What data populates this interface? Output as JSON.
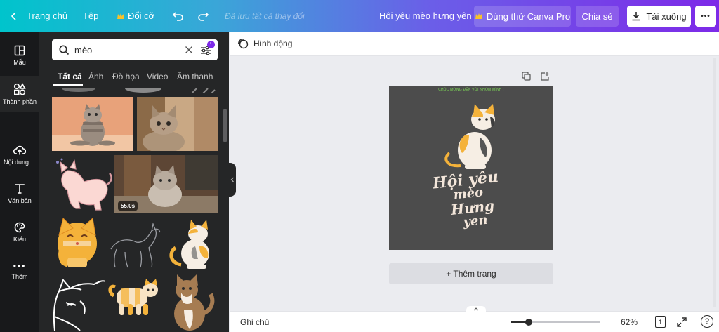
{
  "topbar": {
    "home_label": "Trang chủ",
    "file_label": "Tệp",
    "resize_label": "Đổi cỡ",
    "save_status": "Đã lưu tất cả thay đổi",
    "design_title": "Hội yêu mèo hưng yên",
    "try_pro_label": "Dùng thử Canva Pro",
    "share_label": "Chia sẻ",
    "download_label": "Tải xuống",
    "more_label": "•••"
  },
  "rail": {
    "items": [
      {
        "label": "Mẫu",
        "icon": "template-icon"
      },
      {
        "label": "Thành phần",
        "icon": "elements-icon"
      },
      {
        "label": "Nội dung ...",
        "icon": "upload-icon"
      },
      {
        "label": "Văn bản",
        "icon": "text-icon"
      },
      {
        "label": "Kiểu",
        "icon": "palette-icon"
      },
      {
        "label": "Thêm",
        "icon": "more-dots-icon"
      }
    ]
  },
  "search": {
    "value": "mèo",
    "filter_badge": "1"
  },
  "tabs": [
    "Tất cả",
    "Ảnh",
    "Đồ họa",
    "Video",
    "Âm thanh"
  ],
  "results": {
    "video_duration": "55.0s"
  },
  "editor": {
    "animate_label": "Hình động",
    "add_page_label": "+ Thêm trang"
  },
  "design": {
    "banner_text": "CHÚC MỪNG ĐẾN VỚI NHÓM MÌNH !",
    "script_lines": [
      "Hội yêu",
      "mèo",
      "Hưng",
      "yen"
    ],
    "background_color": "#4c4c4c",
    "banner_color": "#7ed957",
    "script_color": "#f3e6da"
  },
  "bottombar": {
    "notes_label": "Ghi chú",
    "zoom_level": "62%",
    "zoom_fraction": 0.2,
    "page_count": "1",
    "help_label": "?"
  },
  "colors": {
    "accent_purple": "#7d2ae8",
    "accent_teal": "#00c4cc",
    "panel_bg": "#252627",
    "rail_bg": "#18191b"
  }
}
